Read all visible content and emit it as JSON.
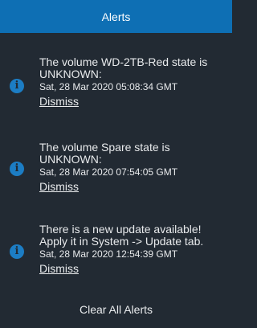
{
  "header": {
    "title": "Alerts"
  },
  "alerts": [
    {
      "icon": "info-icon",
      "message": "The volume WD-2TB-Red state is UNKNOWN:",
      "timestamp": "Sat, 28 Mar 2020 05:08:34 GMT",
      "dismiss_label": "Dismiss"
    },
    {
      "icon": "info-icon",
      "message": "The volume Spare state is UNKNOWN:",
      "timestamp": "Sat, 28 Mar 2020 07:54:05 GMT",
      "dismiss_label": "Dismiss"
    },
    {
      "icon": "info-icon",
      "message": "There is a new update available! Apply it in System -> Update tab.",
      "timestamp": "Sat, 28 Mar 2020 12:54:39 GMT",
      "dismiss_label": "Dismiss"
    }
  ],
  "footer": {
    "clear_all_label": "Clear All Alerts"
  },
  "colors": {
    "header_bg": "#0e6fb4",
    "panel_bg": "#222a33",
    "info_icon": "#1c7dc4",
    "text": "#e8eaec"
  }
}
